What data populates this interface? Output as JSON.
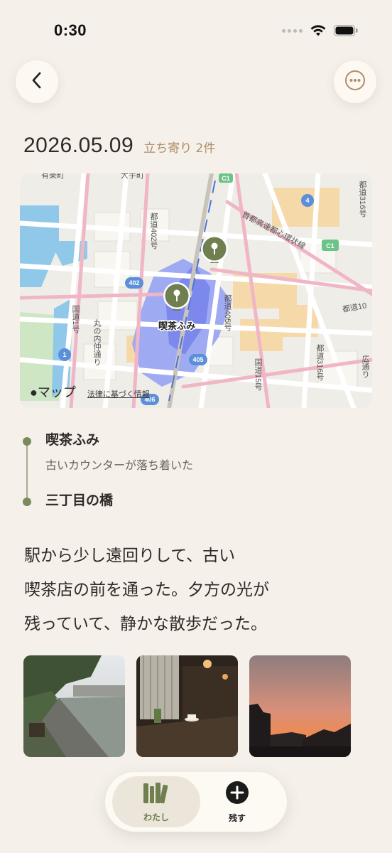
{
  "status_bar": {
    "time": "0:30"
  },
  "header": {
    "back_icon": "chevron-left-icon",
    "more_icon": "ellipsis-icon"
  },
  "entry": {
    "date": "2026.05.09",
    "stops_label": "立ち寄り 2件"
  },
  "map": {
    "brand": "マップ",
    "legal": "法律に基づく情報",
    "pin_label": "喫茶ふみ",
    "labels": {
      "top_left": "有楽町",
      "top_mid": "大手町",
      "c1_a": "C1",
      "c1_b": "C1",
      "route4": "4",
      "route402": "402",
      "route405": "405",
      "route406": "406",
      "route1": "1",
      "toto_402": "都道402号",
      "toto_405": "都道405号",
      "toto_316_top": "都道316号",
      "toto_316_bottom": "都道316号",
      "kokudo1": "国道1号",
      "kokudo15": "国道15号",
      "shuto": "首都高速都心環状線",
      "marunouchi": "丸の内仲通り",
      "toto10": "都道10",
      "right_edge": "広通り"
    },
    "accent_color": "#6f7f50"
  },
  "timeline": [
    {
      "title": "喫茶ふみ",
      "note": "古いカウンターが落ち着いた"
    },
    {
      "title": "三丁目の橋",
      "note": ""
    }
  ],
  "journal": {
    "lines": [
      "駅から少し遠回りして、古い",
      "喫茶店の前を通った。夕方の光が",
      "残っていて、静かな散歩だった。"
    ]
  },
  "photos": [
    "river-photo",
    "cafe-photo",
    "sunset-photo"
  ],
  "tabs": [
    {
      "label": "わたし",
      "icon": "books-icon",
      "active": true
    },
    {
      "label": "残す",
      "icon": "plus-circle-icon",
      "active": false
    }
  ],
  "colors": {
    "background": "#f5f0ea",
    "accent": "#6f7f50",
    "muted_brown": "#b08d68"
  }
}
